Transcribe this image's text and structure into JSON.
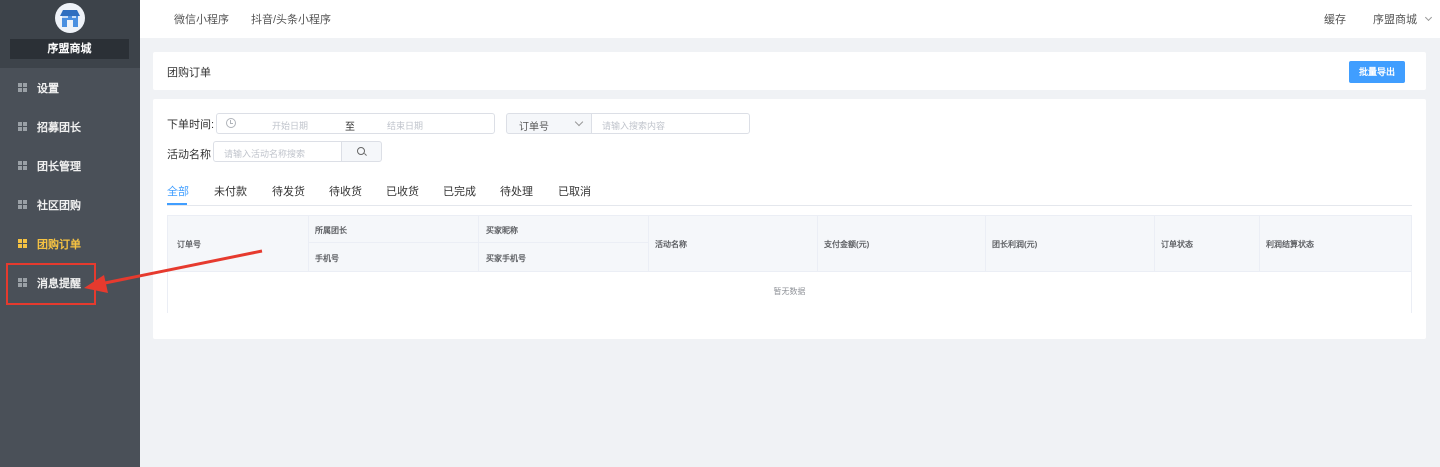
{
  "sidebar": {
    "store_name": "序盟商城",
    "items": [
      {
        "label": "设置",
        "active": false
      },
      {
        "label": "招募团长",
        "active": false
      },
      {
        "label": "团长管理",
        "active": false
      },
      {
        "label": "社区团购",
        "active": false
      },
      {
        "label": "团购订单",
        "active": true
      },
      {
        "label": "消息提醒",
        "active": false
      }
    ]
  },
  "topbar": {
    "links": [
      "微信小程序",
      "抖音/头条小程序"
    ],
    "cache": "缓存",
    "user": "序盟商城"
  },
  "header": {
    "title": "团购订单",
    "export_label": "批量导出"
  },
  "filters": {
    "time_label": "下单时间:",
    "start_placeholder": "开始日期",
    "range_sep": "至",
    "end_placeholder": "结束日期",
    "select_value": "订单号",
    "search_placeholder": "请输入搜索内容",
    "activity_label": "活动名称",
    "activity_placeholder": "请输入活动名称搜索"
  },
  "tabs": [
    "全部",
    "未付款",
    "待发货",
    "待收货",
    "已收货",
    "已完成",
    "待处理",
    "已取消"
  ],
  "table": {
    "headers": {
      "order_no": "订单号",
      "leader": "所属团长",
      "phone": "手机号",
      "buyer_nick": "买家昵称",
      "buyer_phone": "买家手机号",
      "activity": "活动名称",
      "pay_amount": "支付金额(元)",
      "leader_profit": "团长利润(元)",
      "order_status": "订单状态",
      "settle_status": "利润结算状态"
    },
    "empty_text": "暂无数据"
  },
  "colors": {
    "sidebar_bg": "#4a5058",
    "active": "#f5c242",
    "primary": "#409eff",
    "annotation": "#e63a2e"
  }
}
